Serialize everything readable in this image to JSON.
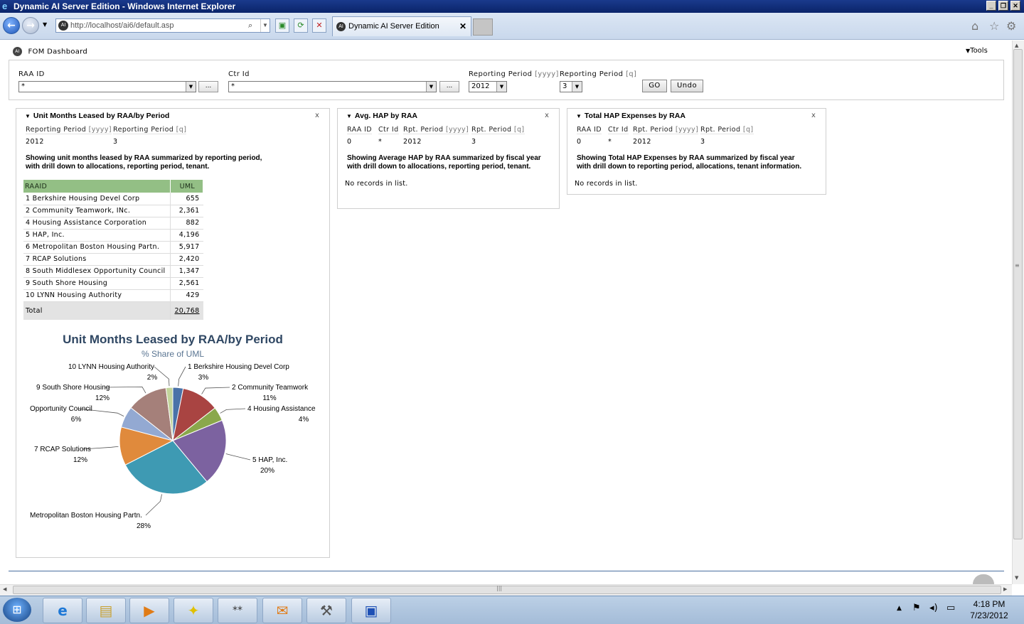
{
  "window": {
    "title": "Dynamic AI Server Edition - Windows Internet Explorer"
  },
  "browser": {
    "url": "http://localhost/ai6/default.asp",
    "tab_title": "Dynamic AI Server Edition"
  },
  "dashboard": {
    "title": "FOM Dashboard",
    "tools_label": "Tools"
  },
  "filters": {
    "raa_id_label": "RAA ID",
    "raa_id_value": "*",
    "ctr_id_label": "Ctr Id",
    "ctr_id_value": "*",
    "period_yyyy_label": "Reporting Period",
    "period_yyyy_unit": "[yyyy]",
    "period_yyyy_value": "2012",
    "period_q_label": "Reporting Period",
    "period_q_unit": "[q]",
    "period_q_value": "3",
    "dots_label": "...",
    "go_label": "GO",
    "undo_label": "Undo"
  },
  "panel1": {
    "title": "Unit Months Leased by RAA/by Period",
    "close": "x",
    "params": {
      "period_yyyy_label": "Reporting Period",
      "period_yyyy_unit": "[yyyy]",
      "period_q_label": "Reporting Period",
      "period_q_unit": "[q]",
      "period_yyyy_value": "2012",
      "period_q_value": "3"
    },
    "description_line1": "Showing unit months leased by RAA summarized by reporting period,",
    "description_line2": "with drill down to allocations, reporting period, tenant.",
    "table": {
      "col_raaid": "RAAID",
      "col_uml": "UML",
      "rows": [
        {
          "name": "1 Berkshire Housing Devel Corp",
          "uml": "655"
        },
        {
          "name": "2 Community Teamwork, INc.",
          "uml": "2,361"
        },
        {
          "name": "4 Housing Assistance Corporation",
          "uml": "882"
        },
        {
          "name": "5 HAP, Inc.",
          "uml": "4,196"
        },
        {
          "name": "6 Metropolitan Boston Housing Partn.",
          "uml": "5,917"
        },
        {
          "name": "7 RCAP Solutions",
          "uml": "2,420"
        },
        {
          "name": "8 South Middlesex Opportunity Council",
          "uml": "1,347"
        },
        {
          "name": "9 South Shore Housing",
          "uml": "2,561"
        },
        {
          "name": "10 LYNN Housing Authority",
          "uml": "429"
        }
      ],
      "total_label": "Total",
      "total_value": "20,768"
    }
  },
  "panel2": {
    "title": "Avg. HAP by RAA",
    "close": "x",
    "params": {
      "raa_label": "RAA ID",
      "ctr_label": "Ctr Id",
      "rpt_yyyy_label": "Rpt. Period",
      "rpt_yyyy_unit": "[yyyy]",
      "rpt_q_label": "Rpt. Period",
      "rpt_q_unit": "[q]",
      "raa_value": "0",
      "ctr_value": "*",
      "rpt_yyyy_value": "2012",
      "rpt_q_value": "3"
    },
    "description_line1": "Showing Average HAP by RAA summarized by fiscal year",
    "description_line2": "with drill down to allocations, reporting period, tenant.",
    "no_records": "No records in list."
  },
  "panel3": {
    "title": "Total HAP Expenses by RAA",
    "close": "x",
    "params": {
      "raa_label": "RAA ID",
      "ctr_label": "Ctr Id",
      "rpt_yyyy_label": "Rpt. Period",
      "rpt_yyyy_unit": "[yyyy]",
      "rpt_q_label": "Rpt. Period",
      "rpt_q_unit": "[q]",
      "raa_value": "0",
      "ctr_value": "*",
      "rpt_yyyy_value": "2012",
      "rpt_q_value": "3"
    },
    "description_line1": "Showing Total HAP Expenses by RAA summarized by fiscal year",
    "description_line2": "with drill down to reporting period, allocations, tenant information.",
    "no_records": "No records in list."
  },
  "chart_data": {
    "type": "pie",
    "title": "Unit Months Leased by RAA/by Period",
    "subtitle": "% Share of UML",
    "slices": [
      {
        "label": "1 Berkshire Housing Devel Corp",
        "value": 655,
        "pct": "3%",
        "color": "#4a72a8"
      },
      {
        "label": "2 Community Teamwork",
        "value": 2361,
        "pct": "11%",
        "color": "#a94442"
      },
      {
        "label": "4 Housing Assistance",
        "value": 882,
        "pct": "4%",
        "color": "#8aa84b"
      },
      {
        "label": "5 HAP, Inc.",
        "value": 4196,
        "pct": "20%",
        "color": "#7c62a0"
      },
      {
        "label": "Metropolitan Boston Housing Partn.",
        "value": 5917,
        "pct": "28%",
        "color": "#3e9ab3"
      },
      {
        "label": "7 RCAP Solutions",
        "value": 2420,
        "pct": "12%",
        "color": "#e08a3c"
      },
      {
        "label": "Opportunity Council",
        "value": 1347,
        "pct": "6%",
        "color": "#93a9d2"
      },
      {
        "label": "9 South Shore Housing",
        "value": 2561,
        "pct": "12%",
        "color": "#a5807a"
      },
      {
        "label": "10 LYNN Housing Authority",
        "value": 429,
        "pct": "2%",
        "color": "#c2d49b"
      }
    ]
  },
  "taskbar": {
    "clock_time": "4:18 PM",
    "clock_date": "7/23/2012"
  }
}
